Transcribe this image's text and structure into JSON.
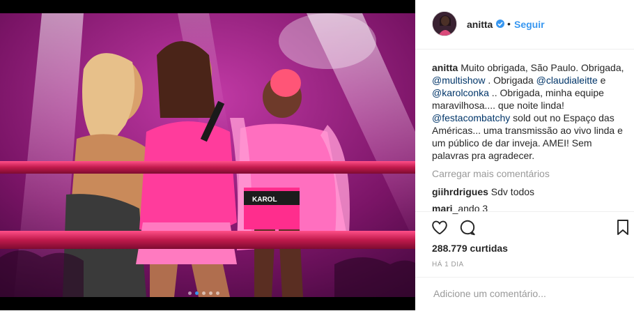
{
  "header": {
    "username": "anitta",
    "separator": "•",
    "follow_label": "Seguir"
  },
  "caption": {
    "username": "anitta",
    "parts": [
      " Muito obrigada, São Paulo. Obrigada, ",
      "@multishow",
      " . Obrigada ",
      "@claudialeitte",
      " e ",
      "@karolconka",
      " .. Obrigada, minha equipe maravilhosa.... que noite linda! ",
      "@festacombatchy",
      " sold out no Espaço das Américas... uma transmissão ao vivo linda e um público de dar inveja. AMEI! Sem palavras pra agradecer."
    ]
  },
  "load_more_label": "Carregar mais comentários",
  "comments": [
    {
      "username": "giihrdrigues",
      "text": " Sdv todos"
    },
    {
      "username": "mari",
      "text": "_ando 3"
    }
  ],
  "likes_text": "288.779 curtidas",
  "timestamp": "HÁ 1 DIA",
  "comment_input": {
    "placeholder": "Adicione um comentário..."
  },
  "photo": {
    "shorts_label": "KAROL",
    "carousel_total": 5,
    "carousel_active": 2
  },
  "colors": {
    "link": "#003569",
    "accent": "#3897f0",
    "muted": "#999999"
  }
}
